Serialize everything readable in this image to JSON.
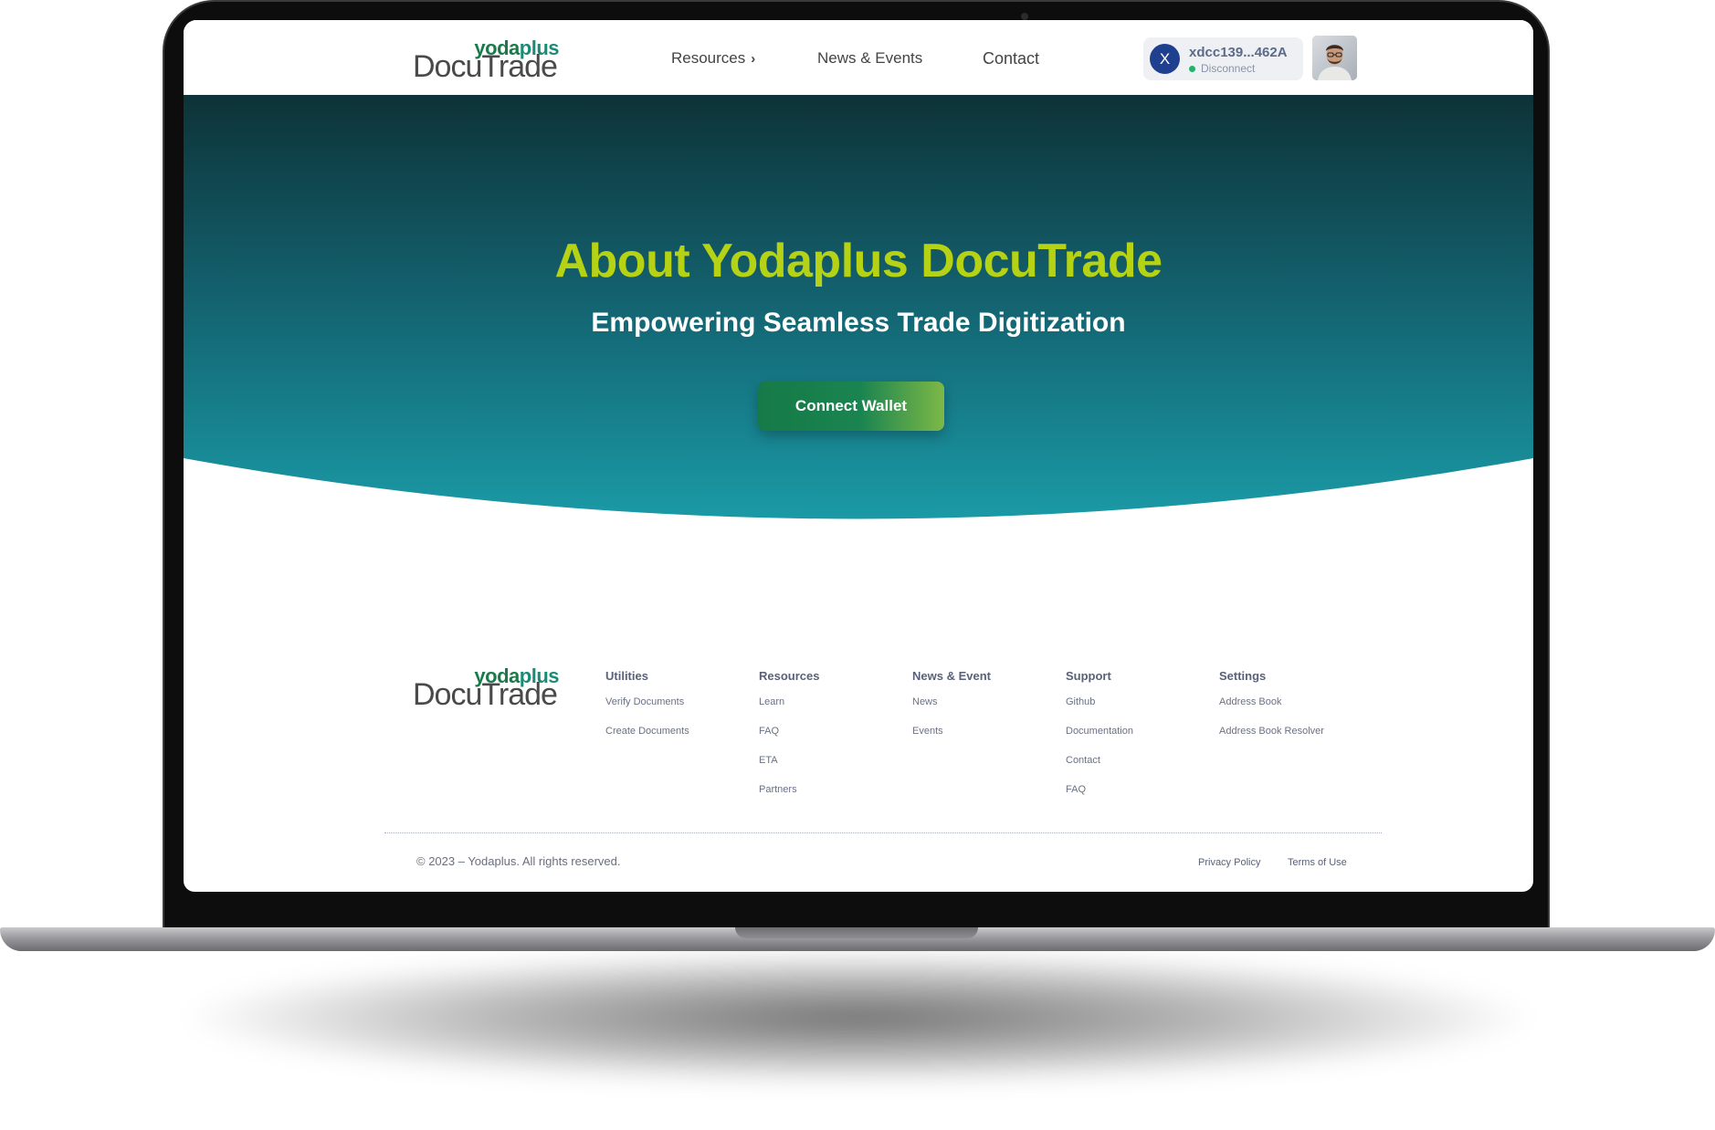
{
  "header": {
    "logo": {
      "top": "yodaplus",
      "bottom": "DocuTrade"
    },
    "nav": [
      {
        "label": "Resources",
        "has_chevron": true
      },
      {
        "label": "News & Events"
      },
      {
        "label": "Contact"
      }
    ],
    "wallet": {
      "avatar_letter": "X",
      "address": "xdcc139...462A",
      "status": "Disconnect",
      "status_color": "#22b36b"
    },
    "user_avatar_icon": "user-photo-icon"
  },
  "hero": {
    "title": "About Yodaplus DocuTrade",
    "subtitle": "Empowering Seamless Trade Digitization",
    "cta": "Connect Wallet",
    "title_color": "#b5d214"
  },
  "footer": {
    "logo": {
      "top": "yodaplus",
      "bottom": "DocuTrade"
    },
    "columns": [
      {
        "heading": "Utilities",
        "links": [
          "Verify Documents",
          "Create Documents"
        ]
      },
      {
        "heading": "Resources",
        "links": [
          "Learn",
          "FAQ",
          "ETA",
          "Partners"
        ]
      },
      {
        "heading": "News & Event",
        "links": [
          "News",
          "Events"
        ]
      },
      {
        "heading": "Support",
        "links": [
          "Github",
          "Documentation",
          "Contact",
          "FAQ"
        ]
      },
      {
        "heading": "Settings",
        "links": [
          "Address Book",
          "Address Book Resolver"
        ]
      }
    ],
    "copyright": "© 2023 – Yodaplus. All rights reserved.",
    "legal": [
      "Privacy Policy",
      "Terms of Use"
    ]
  }
}
